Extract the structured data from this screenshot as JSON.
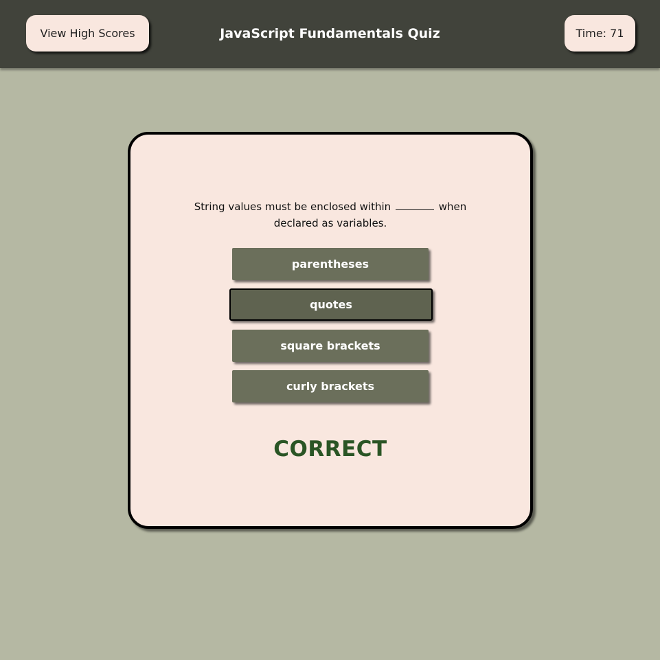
{
  "header": {
    "high_scores_label": "View High Scores",
    "title": "JavaScript Fundamentals Quiz",
    "timer_label": "Time:",
    "timer_value": "71"
  },
  "quiz": {
    "question_before": "String values must be enclosed within",
    "question_after": "when declared as variables.",
    "answers": [
      {
        "label": "parentheses",
        "selected": false
      },
      {
        "label": "quotes",
        "selected": true
      },
      {
        "label": "square brackets",
        "selected": false
      },
      {
        "label": "curly brackets",
        "selected": false
      }
    ],
    "feedback": "CORRECT"
  },
  "colors": {
    "background": "#b5b8a3",
    "header": "#41433b",
    "card": "#f9e7df",
    "answer_button": "#6b6f5b",
    "answer_selected": "#5f6350",
    "feedback_correct": "#2a5525"
  }
}
